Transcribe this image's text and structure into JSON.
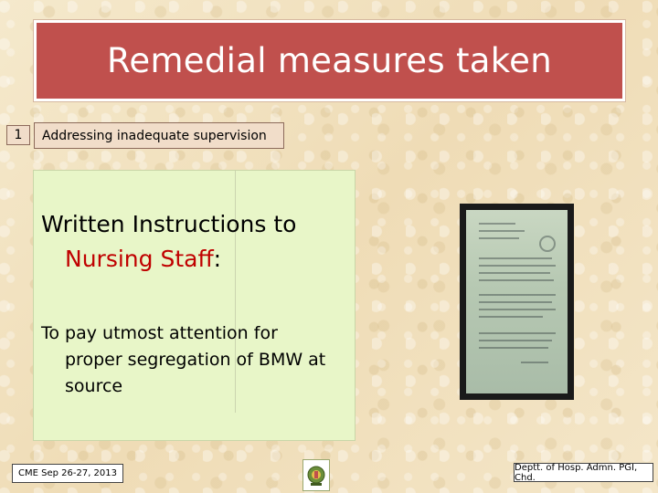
{
  "slide": {
    "title": "Remedial measures taken",
    "item_number": "1",
    "item_label": "Addressing inadequate supervision",
    "heading_line1": "Written Instructions to",
    "heading_red": "Nursing Staff",
    "heading_colon": ":",
    "para_line1": "To pay utmost attention for",
    "para_line2": "proper  segregation of BMW at",
    "para_line3": "source"
  },
  "footer": {
    "left": "CME Sep 26-27, 2013",
    "right": "Deptt. of Hosp. Admn. PGI, Chd."
  },
  "colors": {
    "title_bg": "#c0504d",
    "highlight_red": "#c00000",
    "content_bg": "#e8f6c8",
    "item_bg": "#f1ddc9"
  },
  "icons": {
    "logo": "institute-emblem-icon",
    "photo": "document-photo"
  }
}
